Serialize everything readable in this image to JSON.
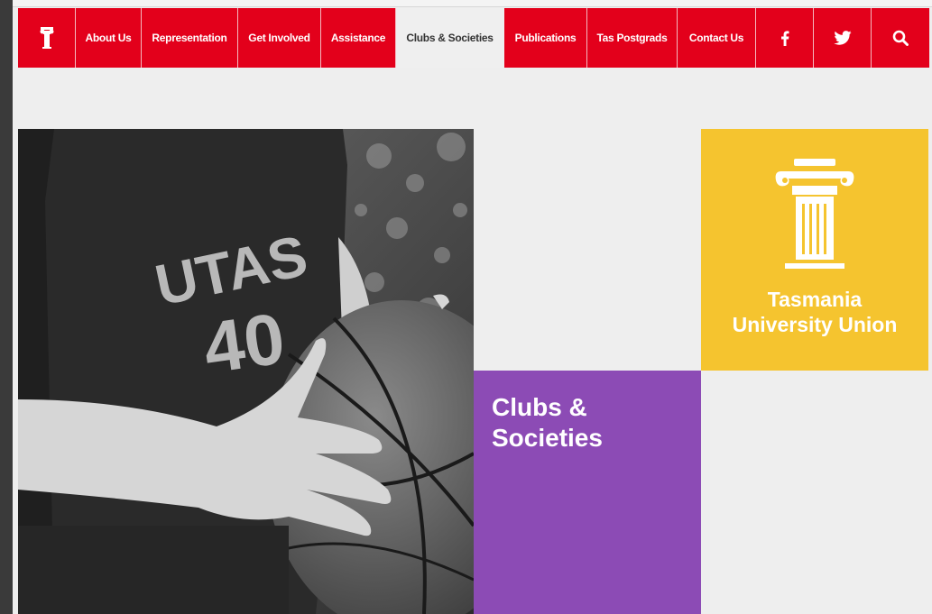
{
  "nav": {
    "home_icon": "column-logo-icon",
    "items": [
      {
        "label": "About Us"
      },
      {
        "label": "Representation"
      },
      {
        "label": "Get Involved"
      },
      {
        "label": "Assistance"
      },
      {
        "label": "Clubs & Societies",
        "active": true
      },
      {
        "label": "Publications"
      },
      {
        "label": "Tas Postgrads"
      },
      {
        "label": "Contact Us"
      }
    ],
    "social": [
      "facebook-icon",
      "twitter-icon",
      "search-icon"
    ]
  },
  "hero": {
    "photo": {
      "jersey_text": "UTAS",
      "jersey_number": "40"
    },
    "section_title_line1": "Clubs &",
    "section_title_line2": "Societies"
  },
  "logo": {
    "icon": "column-logo-icon",
    "line1": "Tasmania",
    "line2": "University Union"
  },
  "colors": {
    "nav_red": "#e3001b",
    "purple": "#8c4bb5",
    "yellow": "#f5c42f",
    "page_bg": "#eeeeee"
  }
}
